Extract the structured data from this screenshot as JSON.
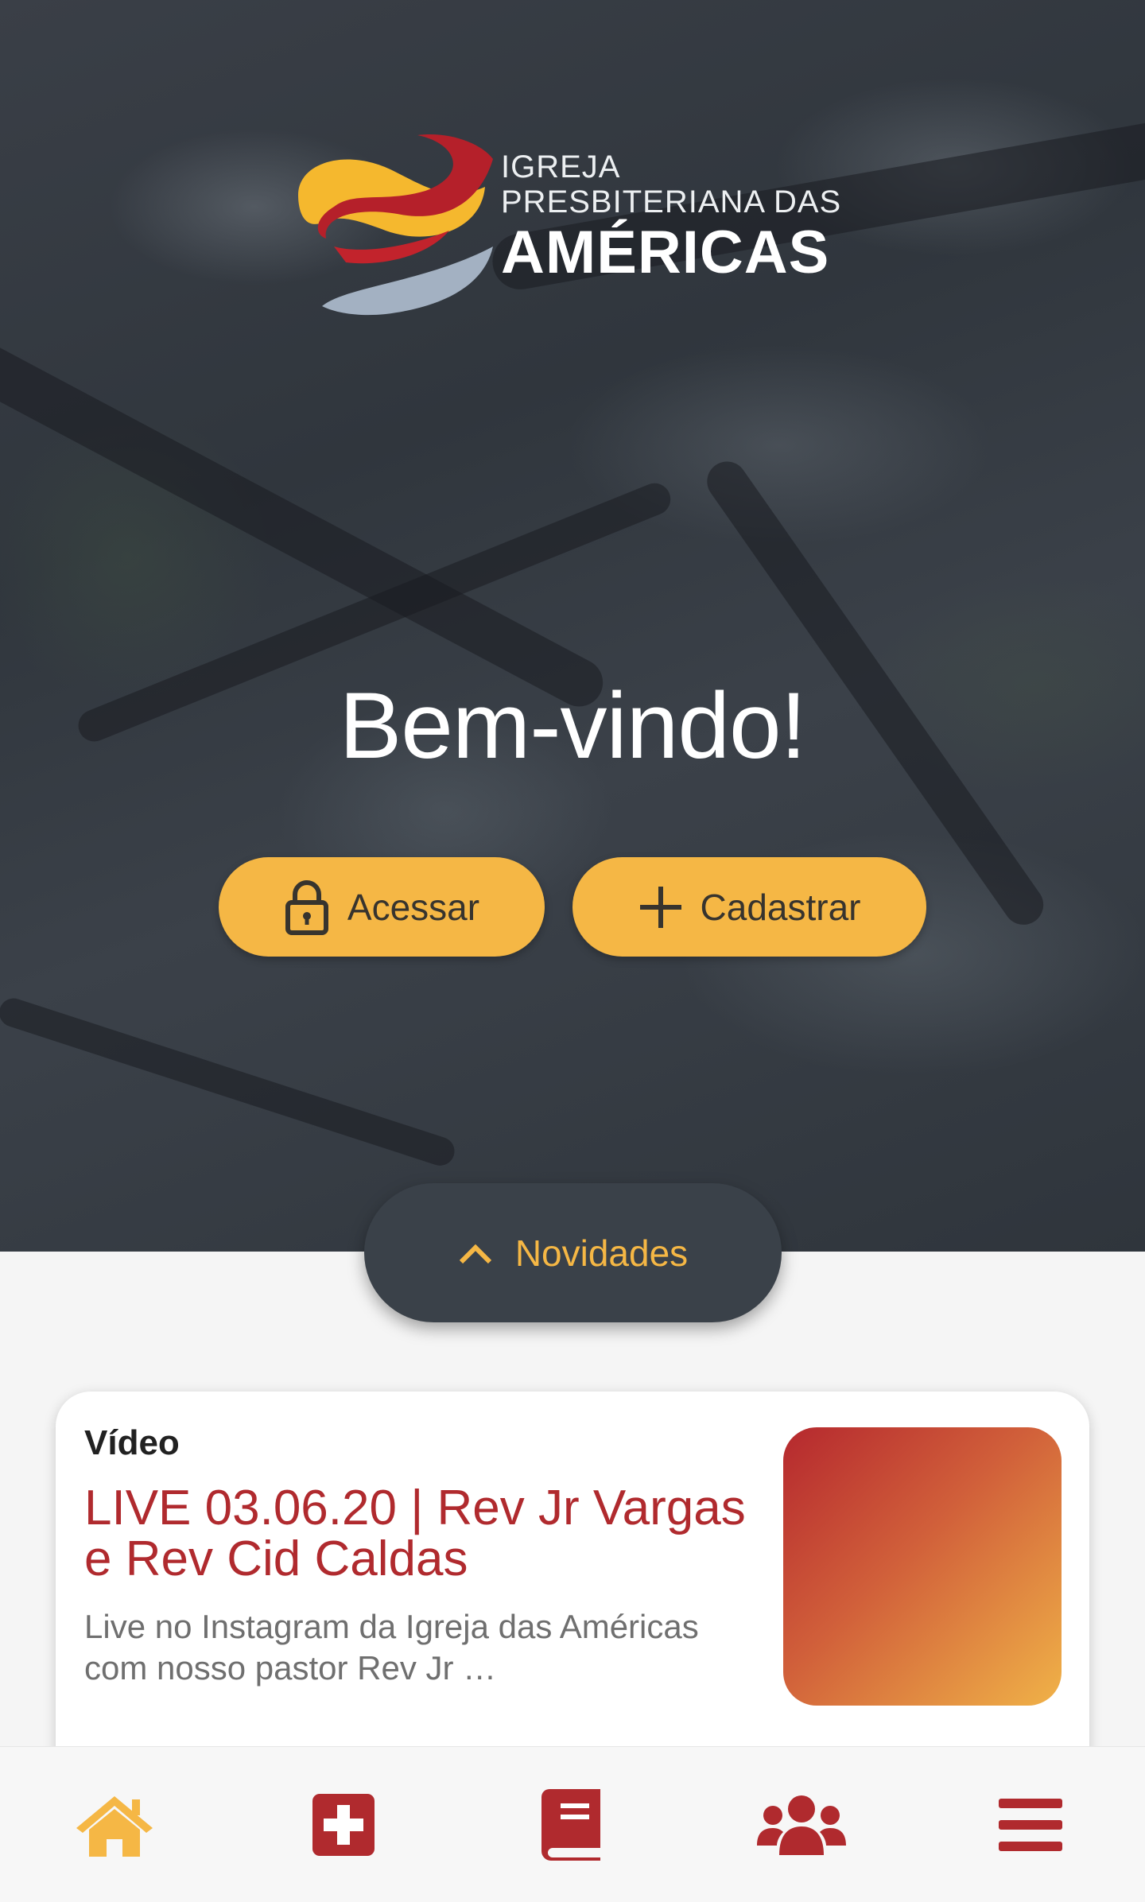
{
  "header": {
    "logo": {
      "line1": "IGREJA",
      "line2": "PRESBITERIANA DAS",
      "line3": "AMÉRICAS"
    },
    "welcome": "Bem-vindo!"
  },
  "actions": {
    "access_label": "Acessar",
    "signup_label": "Cadastrar"
  },
  "news": {
    "toggle_label": "Novidades"
  },
  "feed": [
    {
      "type": "Vídeo",
      "title": "LIVE 03.06.20 | Rev Jr Vargas e Rev Cid Caldas",
      "description": "Live no Instagram da Igreja das Américas com nosso pastor Rev Jr …"
    }
  ],
  "bottom_nav": [
    {
      "icon": "home-icon",
      "active": true
    },
    {
      "icon": "medical-cross-icon",
      "active": false
    },
    {
      "icon": "bible-book-icon",
      "active": false
    },
    {
      "icon": "users-group-icon",
      "active": false
    },
    {
      "icon": "menu-icon",
      "active": false
    }
  ],
  "colors": {
    "accent": "#f5b745",
    "brand_red": "#b02a2e",
    "dark_pill": "#3a4149",
    "logo_yellow": "#f5b82e",
    "logo_red": "#b5202a",
    "logo_gray": "#a3b1c2"
  }
}
